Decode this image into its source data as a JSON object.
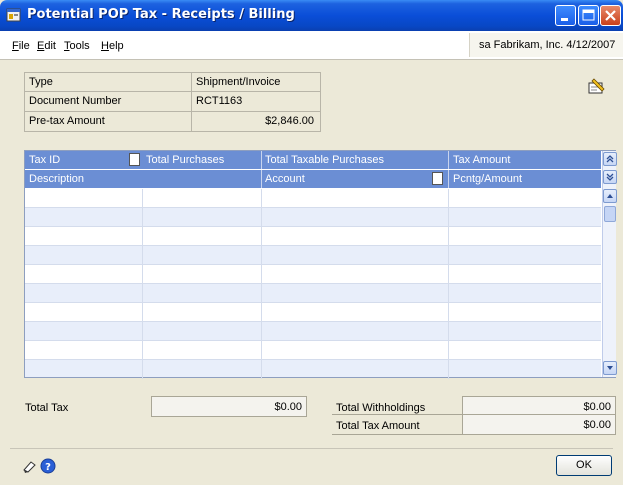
{
  "window": {
    "title": "Potential  POP Tax - Receipts / Billing"
  },
  "menu": {
    "items": [
      "File",
      "Edit",
      "Tools",
      "Help"
    ],
    "underline": [
      "F",
      "E",
      "T",
      "H"
    ],
    "rest": [
      "ile",
      "dit",
      "ools",
      "elp"
    ],
    "user_info": "sa  Fabrikam, Inc.  4/12/2007"
  },
  "header": {
    "type_label": "Type",
    "type_value": "Shipment/Invoice",
    "docnum_label": "Document Number",
    "docnum_value": "RCT1163",
    "pretax_label": "Pre-tax Amount",
    "pretax_value": "$2,846.00"
  },
  "grid": {
    "header_row1": [
      "Tax ID",
      "Total Purchases",
      "Total Taxable Purchases",
      "Tax Amount"
    ],
    "header_row2": [
      "Description",
      "Account",
      "Pcntg/Amount"
    ],
    "row_count": 10
  },
  "totals": {
    "total_tax_label": "Total Tax",
    "total_tax_value": "$0.00",
    "total_withholdings_label": "Total Withholdings",
    "total_withholdings_value": "$0.00",
    "total_tax_amount_label": "Total Tax Amount",
    "total_tax_amount_value": "$0.00"
  },
  "buttons": {
    "ok_label": "OK"
  },
  "colors": {
    "titlebar": "#0a4ed8",
    "grid_header": "#6b8ed4",
    "grid_alt_row": "#e8eefa",
    "window_bg": "#ece9d8"
  },
  "icons": [
    "app-icon",
    "minimize-icon",
    "maximize-icon",
    "close-icon",
    "note-icon",
    "form-note-icon",
    "collapse-icon",
    "expand-icon",
    "scroll-up-icon",
    "scroll-down-icon",
    "pencil-icon",
    "help-icon"
  ]
}
